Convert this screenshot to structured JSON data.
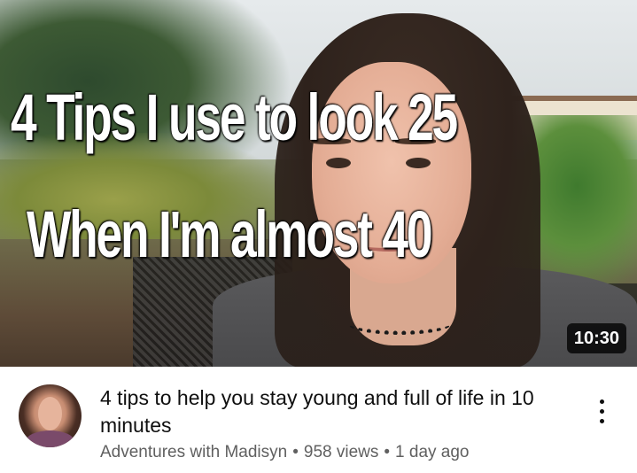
{
  "thumbnail": {
    "overlay_line1": "4 Tips I use to look 25",
    "overlay_line2": "When I'm almost 40",
    "duration": "10:30"
  },
  "video": {
    "title": "4 tips to help you stay young and full of life in 10 minutes",
    "channel": "Adventures with Madisyn",
    "separator": "•",
    "views": "958 views",
    "age": "1 day ago"
  },
  "icons": {
    "more": "more-vert-icon",
    "avatar": "channel-avatar"
  },
  "colors": {
    "title": "#0f0f0f",
    "meta": "#606060",
    "duration_bg": "#000000"
  }
}
